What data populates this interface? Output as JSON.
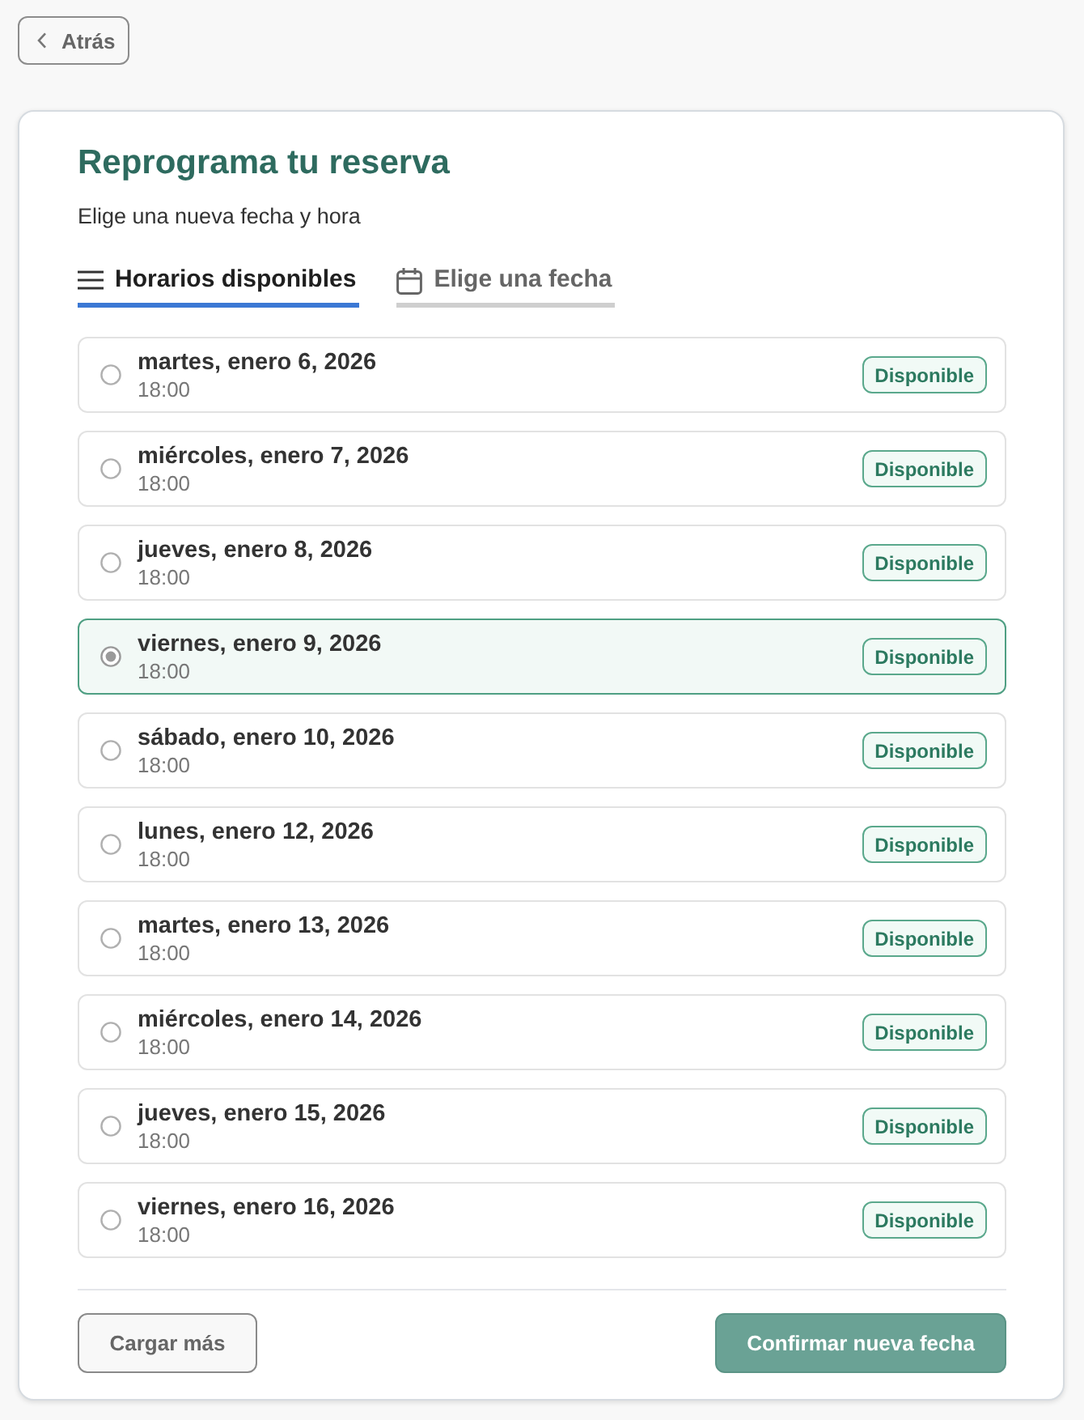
{
  "back_button": {
    "label": "Atrás"
  },
  "card": {
    "title": "Reprograma tu reserva",
    "subtitle": "Elige una nueva fecha y hora"
  },
  "tabs": [
    {
      "label": "Horarios disponibles",
      "kind": "list",
      "selected": true
    },
    {
      "label": "Elige una fecha",
      "kind": "calendar",
      "selected": false
    }
  ],
  "slots": [
    {
      "date": "martes, enero 6, 2026",
      "time": "18:00",
      "status": "Disponible",
      "selected": false
    },
    {
      "date": "miércoles, enero 7, 2026",
      "time": "18:00",
      "status": "Disponible",
      "selected": false
    },
    {
      "date": "jueves, enero 8, 2026",
      "time": "18:00",
      "status": "Disponible",
      "selected": false
    },
    {
      "date": "viernes, enero 9, 2026",
      "time": "18:00",
      "status": "Disponible",
      "selected": true
    },
    {
      "date": "sábado, enero 10, 2026",
      "time": "18:00",
      "status": "Disponible",
      "selected": false
    },
    {
      "date": "lunes, enero 12, 2026",
      "time": "18:00",
      "status": "Disponible",
      "selected": false
    },
    {
      "date": "martes, enero 13, 2026",
      "time": "18:00",
      "status": "Disponible",
      "selected": false
    },
    {
      "date": "miércoles, enero 14, 2026",
      "time": "18:00",
      "status": "Disponible",
      "selected": false
    },
    {
      "date": "jueves, enero 15, 2026",
      "time": "18:00",
      "status": "Disponible",
      "selected": false
    },
    {
      "date": "viernes, enero 16, 2026",
      "time": "18:00",
      "status": "Disponible",
      "selected": false
    }
  ],
  "buttons": [
    {
      "label": "Cargar más",
      "kind": "secondary"
    },
    {
      "label": "Confirmar nueva fecha",
      "kind": "primary"
    }
  ]
}
